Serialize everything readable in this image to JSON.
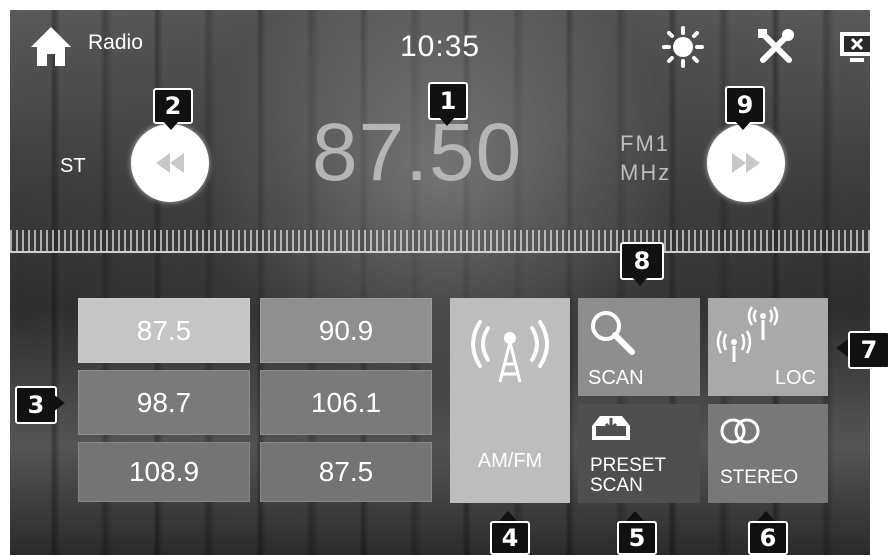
{
  "header": {
    "title": "Radio",
    "clock": "10:35",
    "icons": [
      "home-icon",
      "brightness-icon",
      "settings-icon",
      "screen-off-icon"
    ]
  },
  "tuner": {
    "frequency": "87.50",
    "band": "FM1",
    "unit": "MHz",
    "stereo_indicator": "ST"
  },
  "presets": [
    {
      "label": "87.5",
      "selected": true
    },
    {
      "label": "90.9",
      "selected": false
    },
    {
      "label": "98.7",
      "selected": false
    },
    {
      "label": "106.1",
      "selected": false
    },
    {
      "label": "108.9",
      "selected": false
    },
    {
      "label": "87.5",
      "selected": false
    }
  ],
  "controls": {
    "am_fm": "AM/FM",
    "scan": "SCAN",
    "loc": "LOC",
    "preset_scan_line1": "PRESET",
    "preset_scan_line2": "SCAN",
    "stereo": "STEREO"
  },
  "callouts": [
    "1",
    "2",
    "3",
    "4",
    "5",
    "6",
    "7",
    "8",
    "9"
  ],
  "colors": {
    "callout_bg": "#111111",
    "tile_bg": "#8f8f8f",
    "tile_light": "#c5c5c5",
    "tile_dark": "#4f4f4f"
  }
}
